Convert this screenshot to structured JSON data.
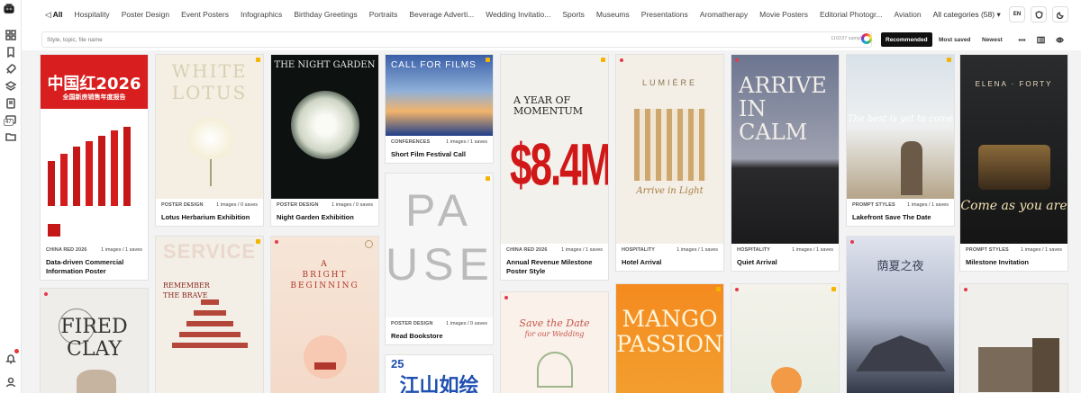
{
  "nav": {
    "tabs": [
      "All",
      "Hospitality",
      "Poster Design",
      "Event Posters",
      "Infographics",
      "Birthday Greetings",
      "Portraits",
      "Beverage Adverti...",
      "Wedding Invitatio...",
      "Sports",
      "Museums",
      "Presentations",
      "Aromatherapy",
      "Movie Posters",
      "Editorial Photogr...",
      "Aviation"
    ],
    "all_categories": "All categories (58)",
    "lang": "EN"
  },
  "rail": {
    "badge": "47"
  },
  "search": {
    "placeholder": "Style, topic, file name",
    "count": "110237 sampl..."
  },
  "sort": {
    "recommended": "Recommended",
    "most_saved": "Most saved",
    "newest": "Newest"
  },
  "cards": [
    {
      "cat": "CHINA RED 2026",
      "stat": "1 images / 1 saves",
      "title": "Data-driven Commercial Information Poster",
      "thumb": {
        "l1": "中国红2026",
        "l2": "全国新房销售年度报告"
      }
    },
    {
      "cat": "POSTER DESIGN",
      "stat": "1 images / 0 saves",
      "title": "Lotus Herbarium Exhibition",
      "thumb": {
        "l1": "WHITE",
        "l2": "LOTUS"
      }
    },
    {
      "cat": "POSTER DESIGN",
      "stat": "1 images / 0 saves",
      "title": "Night Garden Exhibition",
      "thumb": {
        "l1": "THE NIGHT GARDEN"
      }
    },
    {
      "cat": "CONFERENCES",
      "stat": "1 images / 1 saves",
      "title": "Short Film Festival Call",
      "thumb": {
        "l1": "CALL FOR FILMS"
      }
    },
    {
      "cat": "POSTER DESIGN",
      "stat": "1 images / 0 saves",
      "title": "Read Bookstore",
      "thumb": {
        "l1": "PA",
        "l2": "USE"
      }
    },
    {
      "cat": "CHINA RED 2026",
      "stat": "1 images / 1 saves",
      "title": "Annual Revenue Milestone Poster Style",
      "thumb": {
        "l1": "A YEAR OF",
        "l2": "MOMENTUM",
        "l3": "$8.4M"
      }
    },
    {
      "cat": "HOSPITALITY",
      "stat": "1 images / 1 saves",
      "title": "Hotel Arrival",
      "thumb": {
        "l1": "LUMIÈRE",
        "l2": "Arrive in Light"
      }
    },
    {
      "cat": "HOSPITALITY",
      "stat": "1 images / 1 saves",
      "title": "Quiet Arrival",
      "thumb": {
        "l1": "ARRIVE",
        "l2": "IN",
        "l3": "CALM"
      }
    },
    {
      "cat": "PROMPT STYLES",
      "stat": "1 images / 1 saves",
      "title": "Lakefront Save The Date",
      "thumb": {
        "l1": "The best is yet to come"
      }
    },
    {
      "cat": "PROMPT STYLES",
      "stat": "1 images / 1 saves",
      "title": "Milestone Invitation",
      "thumb": {
        "l1": "ELENA · FORTY",
        "l2": "Come as you are"
      }
    }
  ],
  "lower": {
    "fired": {
      "l1": "FIRED",
      "l2": "CLAY"
    },
    "service": {
      "l1": "SERVICE",
      "l2": "REMEMBER",
      "l3": "THE BRAVE"
    },
    "bright": {
      "l1": "A",
      "l2": "BRIGHT",
      "l3": "BEGINNING"
    },
    "save": {
      "l1": "Save the Date",
      "l2": "for our Wedding"
    },
    "mango": {
      "l1": "MANGO",
      "l2": "PASSION"
    },
    "cn": {
      "l1": "25",
      "l2": "江山如绘"
    },
    "summer": {
      "l1": "荫夏之夜"
    }
  }
}
